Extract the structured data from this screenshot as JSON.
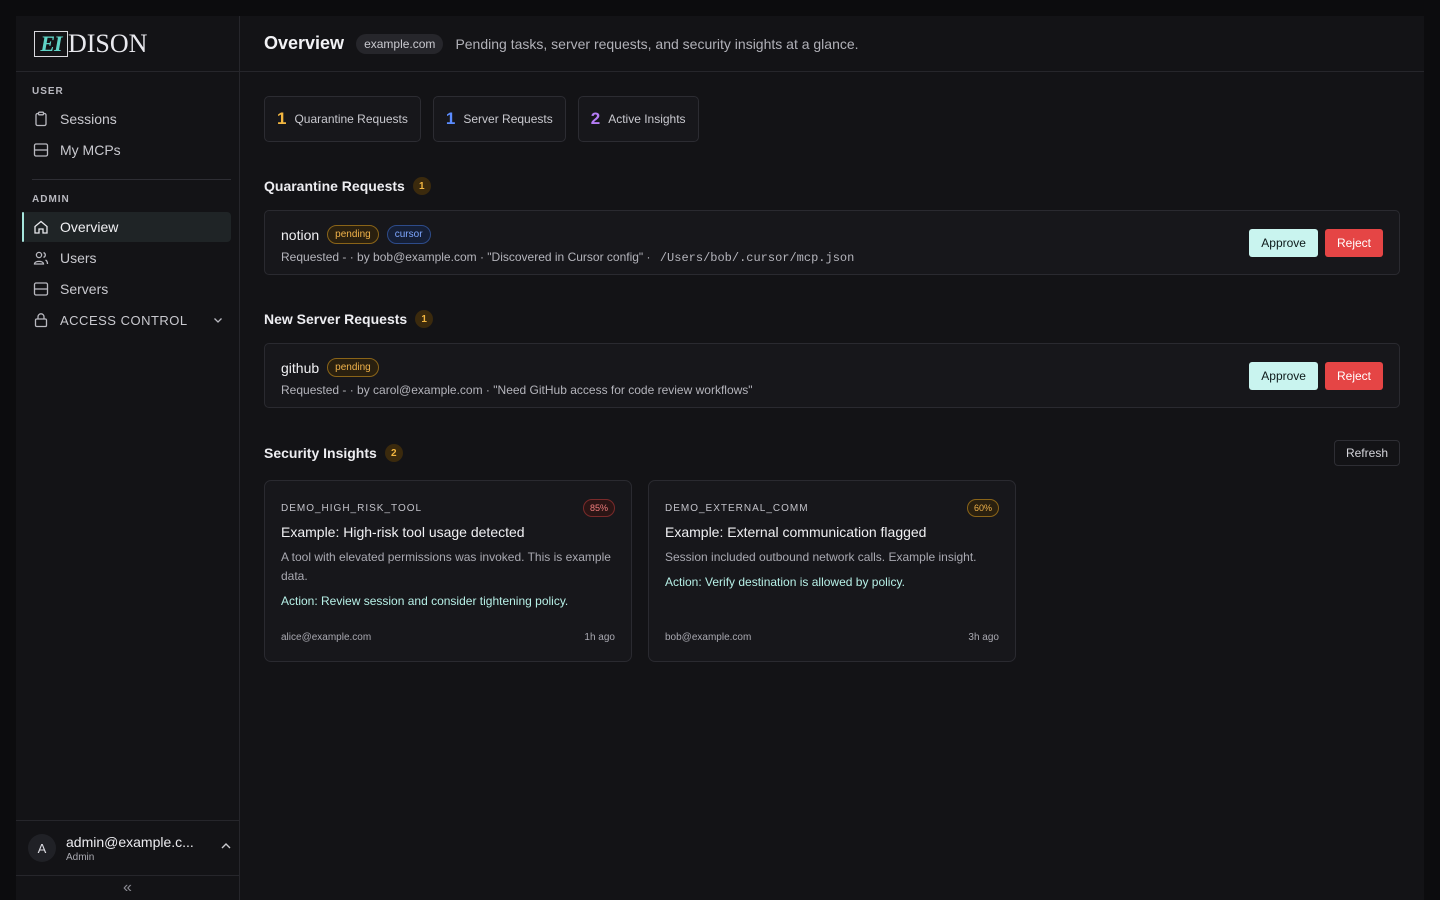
{
  "brand": {
    "logo_mark": "EI",
    "logo_text": "DISON"
  },
  "sidebar": {
    "user_section": "USER",
    "user_items": [
      {
        "label": "Sessions",
        "icon": "clipboard-icon"
      },
      {
        "label": "My MCPs",
        "icon": "server-icon"
      }
    ],
    "admin_section": "ADMIN",
    "admin_items": [
      {
        "label": "Overview",
        "icon": "home-icon",
        "active": true
      },
      {
        "label": "Users",
        "icon": "users-icon"
      },
      {
        "label": "Servers",
        "icon": "server-icon"
      },
      {
        "label": "ACCESS CONTROL",
        "icon": "lock-icon"
      }
    ],
    "user": {
      "avatar": "A",
      "email": "admin@example.c...",
      "role": "Admin"
    },
    "collapse": "«"
  },
  "header": {
    "title": "Overview",
    "domain": "example.com",
    "subtitle": "Pending tasks, server requests, and security insights at a glance."
  },
  "stats": [
    {
      "count": "1",
      "label": "Quarantine Requests",
      "color": "#f2b640"
    },
    {
      "count": "1",
      "label": "Server Requests",
      "color": "#5b8cff"
    },
    {
      "count": "2",
      "label": "Active Insights",
      "color": "#b57cf5"
    }
  ],
  "quarantine": {
    "title": "Quarantine Requests",
    "count": "1",
    "item": {
      "name": "notion",
      "status": "pending",
      "source": "cursor",
      "meta": "Requested - · by bob@example.com · \"Discovered in Cursor config\" · ",
      "path": "/Users/bob/.cursor/mcp.json",
      "approve": "Approve",
      "reject": "Reject"
    }
  },
  "server_requests": {
    "title": "New Server Requests",
    "count": "1",
    "item": {
      "name": "github",
      "status": "pending",
      "meta": "Requested - · by carol@example.com · \"Need GitHub access for code review workflows\"",
      "approve": "Approve",
      "reject": "Reject"
    }
  },
  "insights": {
    "title": "Security Insights",
    "count": "2",
    "refresh": "Refresh",
    "items": [
      {
        "code": "DEMO_HIGH_RISK_TOOL",
        "pct": "85%",
        "title": "Example: High-risk tool usage detected",
        "desc": "A tool with elevated permissions was invoked. This is example data.",
        "action": "Action: Review session and consider tightening policy.",
        "user": "alice@example.com",
        "time": "1h ago"
      },
      {
        "code": "DEMO_EXTERNAL_COMM",
        "pct": "60%",
        "title": "Example: External communication flagged",
        "desc": "Session included outbound network calls. Example insight.",
        "action": "Action: Verify destination is allowed by policy.",
        "user": "bob@example.com",
        "time": "3h ago"
      }
    ]
  }
}
